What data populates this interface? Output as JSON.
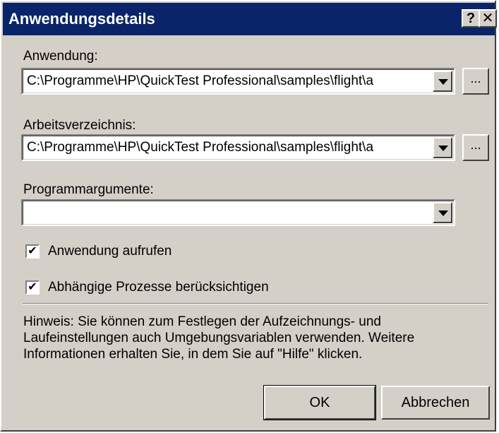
{
  "window": {
    "title": "Anwendungsdetails",
    "help_glyph": "?",
    "close_glyph": "✕"
  },
  "application": {
    "label": "Anwendung:",
    "value": "C:\\Programme\\HP\\QuickTest Professional\\samples\\flight\\a",
    "browse_label": "..."
  },
  "working_dir": {
    "label": "Arbeitsverzeichnis:",
    "value": "C:\\Programme\\HP\\QuickTest Professional\\samples\\flight\\a",
    "browse_label": "..."
  },
  "arguments": {
    "label": "Programmargumente:",
    "value": ""
  },
  "options": {
    "launch_app": {
      "label": "Anwendung aufrufen",
      "checked": true,
      "glyph": "✔"
    },
    "dependent_processes": {
      "label": "Abhängige Prozesse berücksichtigen",
      "checked": true,
      "glyph": "✔"
    }
  },
  "hint_text": "Hinweis: Sie können zum Festlegen der Aufzeichnungs- und Laufeinstellungen auch Umgebungsvariablen verwenden. Weitere Informationen erhalten Sie, in dem Sie auf \"Hilfe\" klicken.",
  "buttons": {
    "ok": "OK",
    "cancel": "Abbrechen"
  },
  "colors": {
    "title_bar": "#0a246a",
    "dialog_face": "#d4d0c8"
  }
}
